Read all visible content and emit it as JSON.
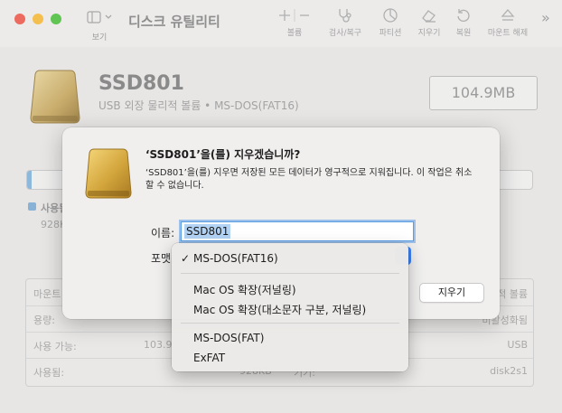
{
  "window": {
    "title": "디스크 유틸리티",
    "view_label": "보기",
    "toolbar": [
      {
        "label": "볼륨",
        "icon": "plus-minus-icon"
      },
      {
        "label": "검사/복구",
        "icon": "stethoscope-icon"
      },
      {
        "label": "파티션",
        "icon": "pie-chart-icon"
      },
      {
        "label": "지우기",
        "icon": "eraser-icon"
      },
      {
        "label": "복원",
        "icon": "restore-icon"
      },
      {
        "label": "마운트 해제",
        "icon": "eject-icon"
      }
    ],
    "more_glyph": "»"
  },
  "disk": {
    "name": "SSD801",
    "subtitle": "USB 외장 물리적 볼륨 • MS-DOS(FAT16)",
    "capacity": "104.9MB",
    "used_fraction": 0.009
  },
  "usage": {
    "used_label": "사용됨",
    "used_value": "928K"
  },
  "info": {
    "rows": [
      {
        "k1": "마운트",
        "v1": "",
        "k2": "",
        "v2": "적 볼륨"
      },
      {
        "k1": "용량:",
        "v1": "",
        "k2": "",
        "v2": "비활성화됨"
      },
      {
        "k1": "사용 가능:",
        "v1": "103.9",
        "k2": "",
        "v2": "USB"
      },
      {
        "k1": "사용됨:",
        "v1": "928KB",
        "k2": "기기:",
        "v2": "disk2s1"
      }
    ]
  },
  "dialog": {
    "title": "‘SSD801’을(를) 지우겠습니까?",
    "message": "‘SSD801’을(를) 지우면 저장된 모든 데이터가 영구적으로 지워집니다. 이 작업은 취소할 수 없습니다.",
    "name_label": "이름:",
    "name_value": "SSD801",
    "format_label": "포맷",
    "erase_button": "지우기"
  },
  "format_menu": {
    "checkmark": "✓",
    "items": [
      "MS-DOS(FAT16)",
      "Mac OS 확장(저널링)",
      "Mac OS 확장(대소문자 구분, 저널링)",
      "MS-DOS(FAT)",
      "ExFAT"
    ],
    "selected": "MS-DOS(FAT16)"
  },
  "colors": {
    "accent": "#3b82f6",
    "close": "#ec6a5e",
    "minimize": "#f4bf4f",
    "zoom": "#61c554",
    "usage_blue": "#88b3d6"
  }
}
